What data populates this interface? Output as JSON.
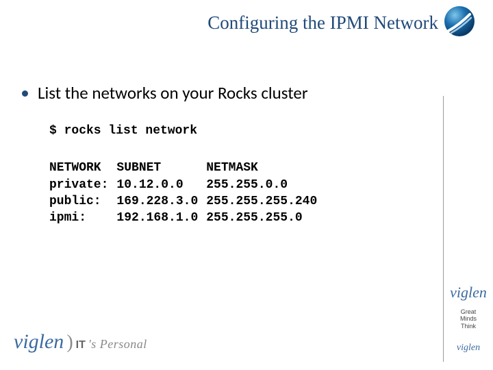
{
  "title": "Configuring the IPMI Network",
  "bullets": [
    "List the networks on your Rocks cluster"
  ],
  "command": "$ rocks list network",
  "output": {
    "headers": [
      "NETWORK",
      "SUBNET",
      "NETMASK"
    ],
    "rows": [
      [
        "private:",
        "10.12.0.0",
        "255.255.0.0"
      ],
      [
        "public:",
        "169.228.3.0",
        "255.255.255.240"
      ],
      [
        "ipmi:",
        "192.168.1.0",
        "255.255.255.0"
      ]
    ]
  },
  "brand": {
    "name": "viglen",
    "name_small": "viglen",
    "it": "IT",
    "slogan": "'s Personal",
    "tag1": "Great",
    "tag2": "Minds",
    "tag3": "Think"
  },
  "colors": {
    "title": "#214a7a",
    "bullet": "#214a7a",
    "brand_blue": "#3a6aa0"
  }
}
